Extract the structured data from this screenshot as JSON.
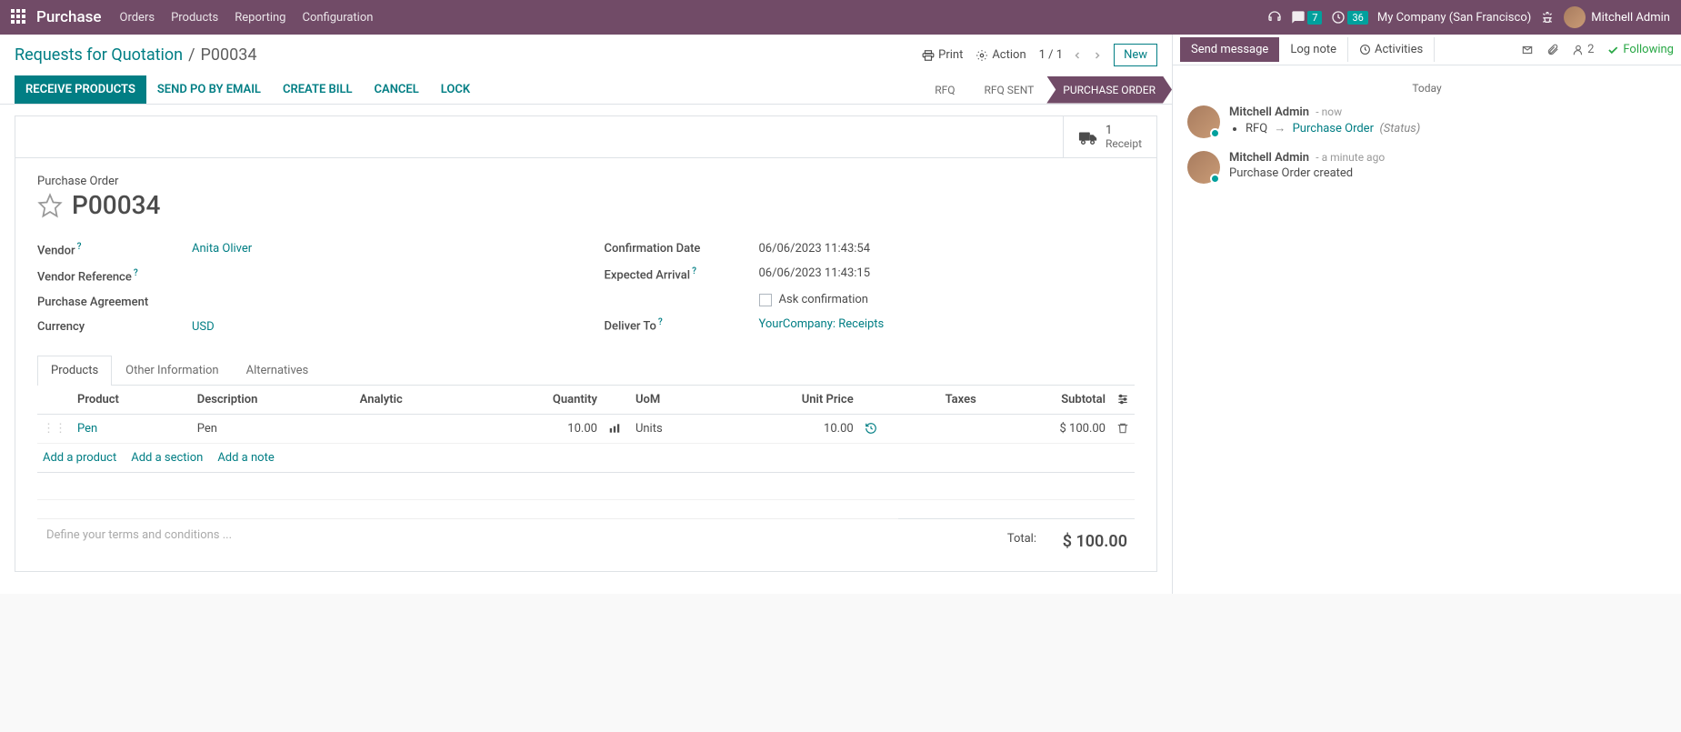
{
  "topbar": {
    "app": "Purchase",
    "menus": [
      "Orders",
      "Products",
      "Reporting",
      "Configuration"
    ],
    "chat_badge": "7",
    "clock_badge": "36",
    "company": "My Company (San Francisco)",
    "user": "Mitchell Admin"
  },
  "breadcrumb": {
    "parent": "Requests for Quotation",
    "current": "P00034"
  },
  "controls": {
    "print": "Print",
    "action": "Action",
    "pager": "1 / 1",
    "new": "New"
  },
  "actions": {
    "receive": "RECEIVE PRODUCTS",
    "email": "SEND PO BY EMAIL",
    "bill": "CREATE BILL",
    "cancel": "CANCEL",
    "lock": "LOCK"
  },
  "status": {
    "s1": "RFQ",
    "s2": "RFQ SENT",
    "s3": "PURCHASE ORDER"
  },
  "stat": {
    "receipt_count": "1",
    "receipt_label": "Receipt"
  },
  "form": {
    "doc_type": "Purchase Order",
    "name": "P00034",
    "vendor_label": "Vendor",
    "vendor": "Anita Oliver",
    "vendor_ref_label": "Vendor Reference",
    "vendor_ref": "",
    "agreement_label": "Purchase Agreement",
    "agreement": "",
    "currency_label": "Currency",
    "currency": "USD",
    "confirm_label": "Confirmation Date",
    "confirm": "06/06/2023 11:43:54",
    "expected_label": "Expected Arrival",
    "expected": "06/06/2023 11:43:15",
    "ask_conf": "Ask confirmation",
    "deliver_label": "Deliver To",
    "deliver": "YourCompany: Receipts"
  },
  "tabs": {
    "products": "Products",
    "other": "Other Information",
    "alt": "Alternatives"
  },
  "columns": {
    "product": "Product",
    "desc": "Description",
    "analytic": "Analytic",
    "qty": "Quantity",
    "uom": "UoM",
    "price": "Unit Price",
    "taxes": "Taxes",
    "subtotal": "Subtotal"
  },
  "line": {
    "product": "Pen",
    "desc": "Pen",
    "qty": "10.00",
    "uom": "Units",
    "price": "10.00",
    "subtotal": "$ 100.00"
  },
  "addlinks": {
    "product": "Add a product",
    "section": "Add a section",
    "note": "Add a note"
  },
  "terms_placeholder": "Define your terms and conditions ...",
  "totals": {
    "total_label": "Total:",
    "total": "$ 100.00"
  },
  "chatter": {
    "send": "Send message",
    "log": "Log note",
    "activities": "Activities",
    "followers": "2",
    "following": "Following",
    "day": "Today",
    "msg1": {
      "author": "Mitchell Admin",
      "time": "now",
      "from": "RFQ",
      "to": "Purchase Order",
      "paren": "(Status)"
    },
    "msg2": {
      "author": "Mitchell Admin",
      "time": "a minute ago",
      "body": "Purchase Order created"
    }
  }
}
